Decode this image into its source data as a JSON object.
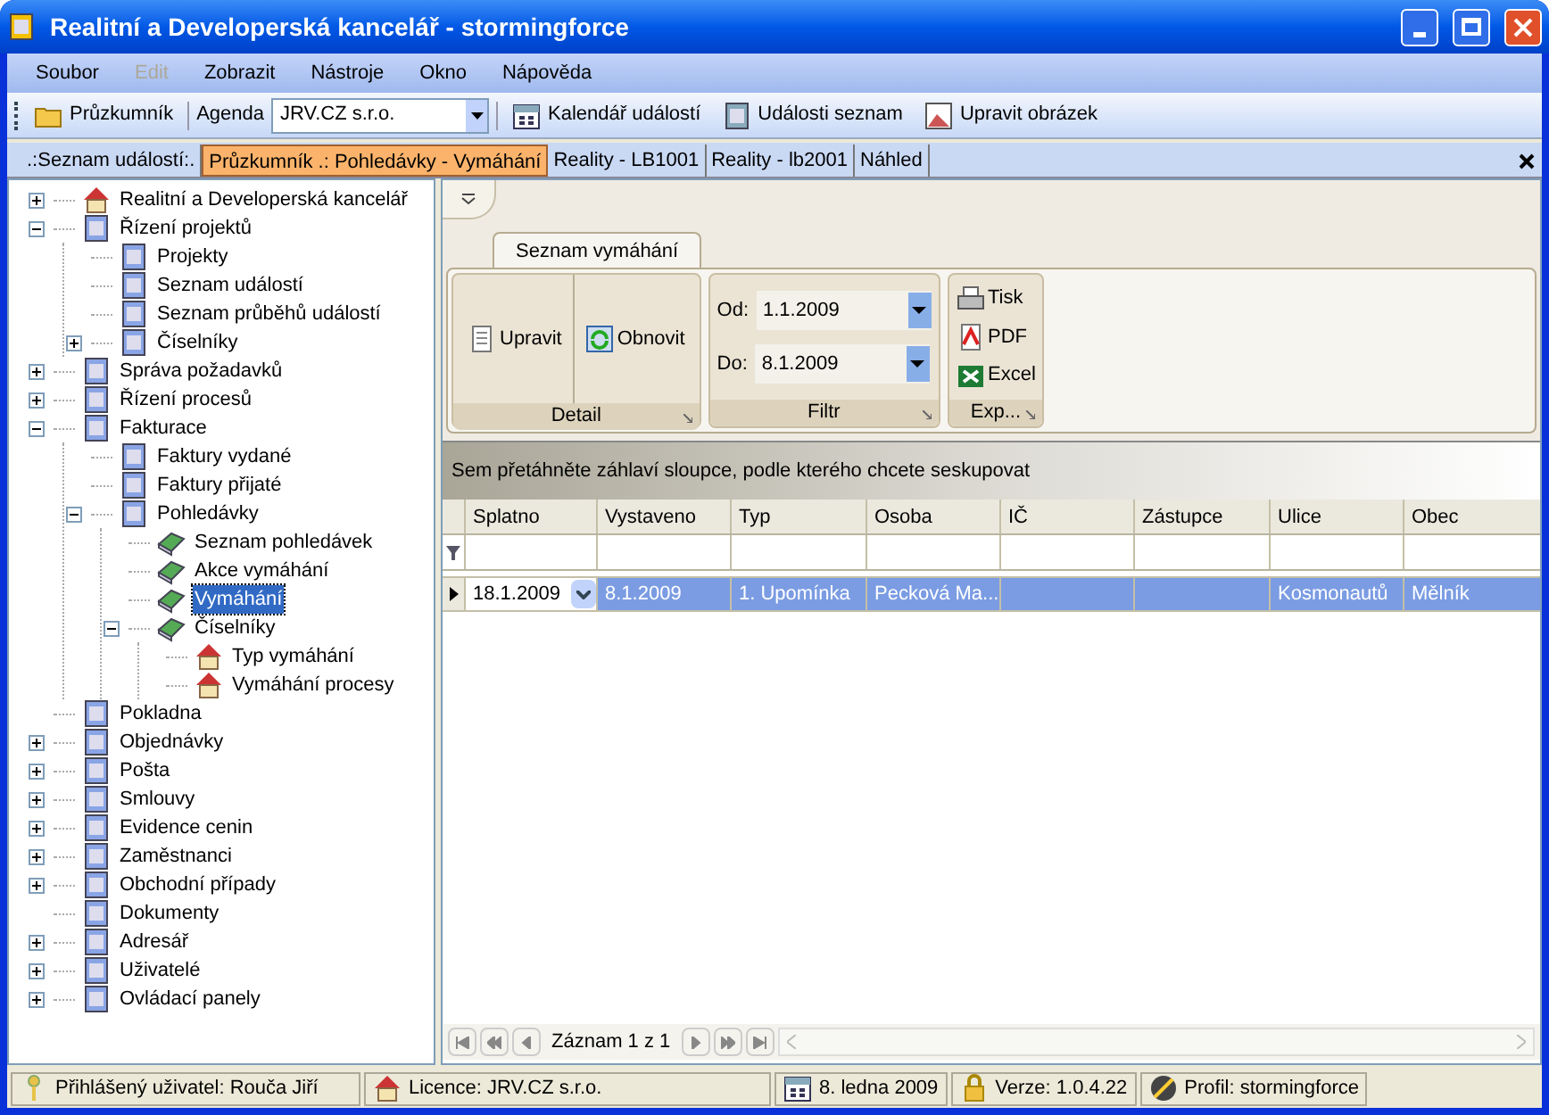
{
  "window": {
    "title": "Realitní a Developerská kancelář - stormingforce"
  },
  "menu": [
    {
      "label": "Soubor",
      "disabled": false
    },
    {
      "label": "Edit",
      "disabled": true
    },
    {
      "label": "Zobrazit",
      "disabled": false
    },
    {
      "label": "Nástroje",
      "disabled": false
    },
    {
      "label": "Okno",
      "disabled": false
    },
    {
      "label": "Nápověda",
      "disabled": false
    }
  ],
  "toolbar": {
    "explorer": "Průzkumník",
    "agenda_label": "Agenda",
    "agenda_value": "JRV.CZ s.r.o.",
    "buttons": [
      "Kalendář událostí",
      "Události seznam",
      "Upravit obrázek"
    ]
  },
  "doc_tabs": [
    {
      "label": ".:Seznam událostí:.",
      "selected": false
    },
    {
      "label": "Průzkumník .: Pohledávky - Vymáhání",
      "selected": true
    },
    {
      "label": "Reality - LB1001",
      "selected": false
    },
    {
      "label": "Reality - lb2001",
      "selected": false
    },
    {
      "label": "Náhled",
      "selected": false
    }
  ],
  "tree": [
    {
      "label": "Realitní a Developerská kancelář",
      "expanded": false,
      "selected": false
    },
    {
      "label": "Řízení projektů",
      "expanded": true,
      "selected": false,
      "children": [
        {
          "label": "Projekty",
          "selected": false
        },
        {
          "label": "Seznam událostí",
          "selected": false
        },
        {
          "label": "Seznam průběhů událostí",
          "selected": false
        },
        {
          "label": "Číselníky",
          "expanded": false,
          "selected": false
        }
      ]
    },
    {
      "label": "Správa požadavků",
      "expanded": false,
      "selected": false
    },
    {
      "label": "Řízení procesů",
      "expanded": false,
      "selected": false
    },
    {
      "label": "Fakturace",
      "expanded": true,
      "selected": false,
      "children": [
        {
          "label": "Faktury vydané",
          "selected": false
        },
        {
          "label": "Faktury přijaté",
          "selected": false
        },
        {
          "label": "Pohledávky",
          "expanded": true,
          "selected": false,
          "children": [
            {
              "label": "Seznam pohledávek",
              "selected": false
            },
            {
              "label": "Akce vymáhání",
              "selected": false
            },
            {
              "label": "Vymáhání",
              "selected": true
            },
            {
              "label": "Číselníky",
              "expanded": true,
              "selected": false,
              "children": [
                {
                  "label": "Typ vymáhání",
                  "selected": false
                },
                {
                  "label": "Vymáhání procesy",
                  "selected": false
                }
              ]
            }
          ]
        }
      ]
    },
    {
      "label": "Pokladna",
      "selected": false
    },
    {
      "label": "Objednávky",
      "expanded": false,
      "selected": false
    },
    {
      "label": "Pošta",
      "expanded": false,
      "selected": false
    },
    {
      "label": "Smlouvy",
      "expanded": false,
      "selected": false
    },
    {
      "label": "Evidence cenin",
      "expanded": false,
      "selected": false
    },
    {
      "label": "Zaměstnanci",
      "expanded": false,
      "selected": false
    },
    {
      "label": "Obchodní případy",
      "expanded": false,
      "selected": false
    },
    {
      "label": "Dokumenty",
      "selected": false
    },
    {
      "label": "Adresář",
      "expanded": false,
      "selected": false
    },
    {
      "label": "Uživatelé",
      "expanded": false,
      "selected": false
    },
    {
      "label": "Ovládací panely",
      "expanded": false,
      "selected": false
    }
  ],
  "ribbon": {
    "tab": "Seznam vymáhání",
    "groups": [
      {
        "kind": "buttons",
        "title": "Detail",
        "buttons": [
          "Upravit",
          "Obnovit"
        ]
      },
      {
        "kind": "filter",
        "title": "Filtr",
        "fields": [
          {
            "label": "Od:",
            "value": "1.1.2009"
          },
          {
            "label": "Do:",
            "value": "8.1.2009"
          }
        ]
      },
      {
        "kind": "export",
        "title": "Exp...",
        "buttons": [
          "Tisk",
          "PDF",
          "Excel"
        ]
      }
    ]
  },
  "grid": {
    "group_hint": "Sem přetáhněte záhlaví sloupce, podle kterého chcete seskupovat",
    "columns": [
      "Splatno",
      "Vystaveno",
      "Typ",
      "Osoba",
      "IČ",
      "Zástupce",
      "Ulice",
      "Obec"
    ],
    "rows": [
      {
        "selected": true,
        "cells": [
          "18.1.2009",
          "8.1.2009",
          "1. Upomínka",
          "Pecková Ma...",
          "",
          "",
          "Kosmonautů",
          "Mělník"
        ]
      }
    ],
    "navigator": "Záznam 1 z 1"
  },
  "status_bar": [
    "Přihlášený uživatel: Rouča Jiří",
    "Licence: JRV.CZ s.r.o.",
    "8. ledna 2009",
    "Verze: 1.0.4.22",
    "Profil: stormingforce"
  ]
}
